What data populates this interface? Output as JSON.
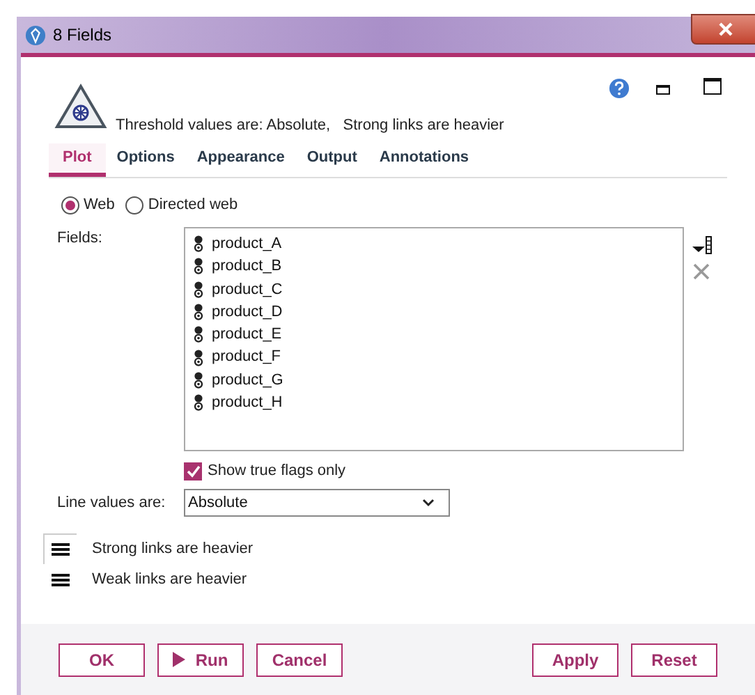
{
  "window": {
    "title": "8 Fields"
  },
  "header": {
    "summary": "Threshold values are: Absolute,   Strong links are heavier"
  },
  "tabs": [
    {
      "label": "Plot",
      "selected": true
    },
    {
      "label": "Options",
      "selected": false
    },
    {
      "label": "Appearance",
      "selected": false
    },
    {
      "label": "Output",
      "selected": false
    },
    {
      "label": "Annotations",
      "selected": false
    }
  ],
  "plot_type": [
    {
      "label": "Web",
      "selected": true
    },
    {
      "label": "Directed web",
      "selected": false
    }
  ],
  "fields": {
    "label": "Fields:",
    "items": [
      "product_A",
      "product_B",
      "product_C",
      "product_D",
      "product_E",
      "product_F",
      "product_G",
      "product_H"
    ]
  },
  "show_true_flags": {
    "label": "Show true flags only",
    "checked": true
  },
  "line_values": {
    "label": "Line values are:",
    "value": "Absolute"
  },
  "link_weights": [
    {
      "label": "Strong links are heavier",
      "selected": true
    },
    {
      "label": "Weak links are heavier",
      "selected": false
    }
  ],
  "buttons_left": [
    {
      "label": "OK",
      "kind": "plain"
    },
    {
      "label": "Run",
      "kind": "run"
    },
    {
      "label": "Cancel",
      "kind": "plain"
    }
  ],
  "buttons_right": [
    {
      "label": "Apply"
    },
    {
      "label": "Reset"
    }
  ]
}
